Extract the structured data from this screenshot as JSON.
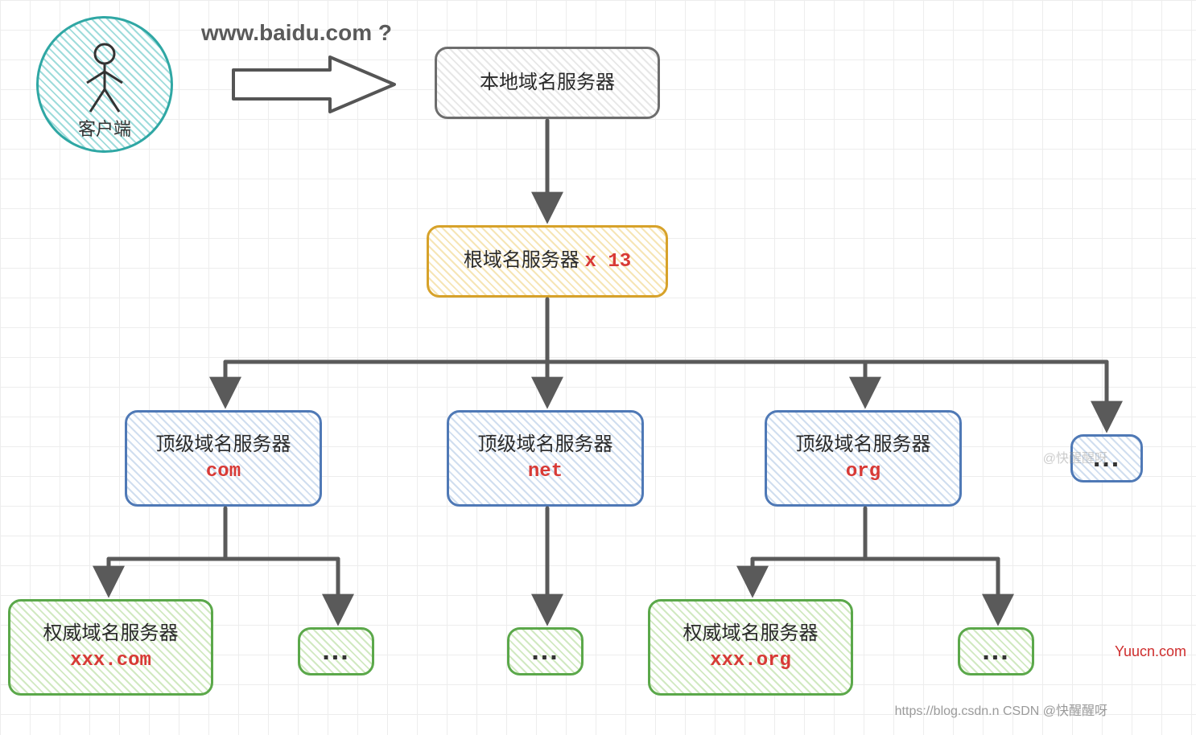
{
  "query_text": "www.baidu.com  ?",
  "client": {
    "label": "客户端"
  },
  "nodes": {
    "local_dns": {
      "title": "本地域名服务器"
    },
    "root_dns": {
      "title": "根域名服务器",
      "count_prefix": "x",
      "count": "13"
    },
    "tld_label": "顶级域名服务器",
    "tld": [
      {
        "tld": "com"
      },
      {
        "tld": "net"
      },
      {
        "tld": "org"
      }
    ],
    "auth_label": "权威域名服务器",
    "auth": [
      {
        "domain": "xxx.com"
      },
      {
        "domain": "xxx.org"
      }
    ],
    "ellipsis": "..."
  },
  "watermarks": {
    "yuucn": "Yuucn.com",
    "csdn": "https://blog.csdn.n  CSDN @快醒醒呀",
    "csdn2": "@快醒醒呀"
  }
}
